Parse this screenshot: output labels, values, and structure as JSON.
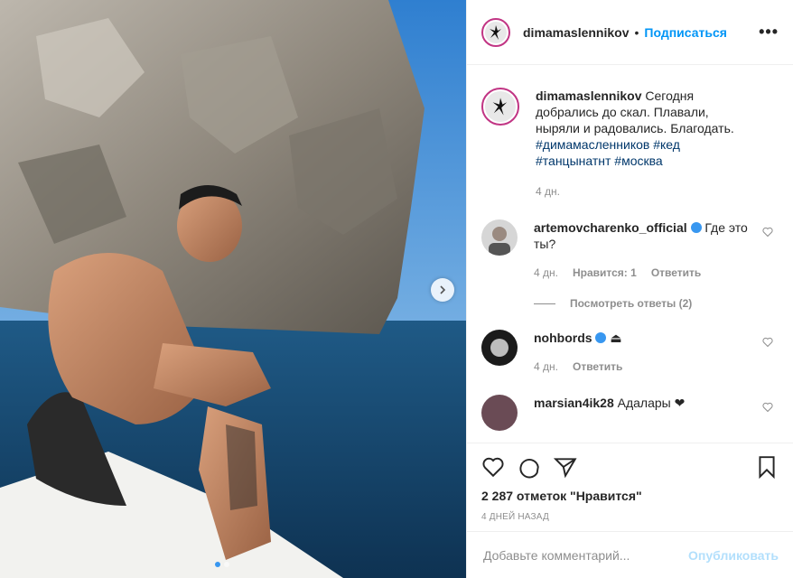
{
  "post": {
    "author": "dimamaslennikov",
    "separator": "•",
    "follow_label": "Подписаться",
    "more_label": "•••"
  },
  "caption": {
    "username": "dimamaslennikov",
    "text": "Сегодня добрались до скал. Плавали, ныряли и радовались. Благодать.",
    "hashtags": "#димамасленников #кед #танцынатнт #москва",
    "time": "4 дн."
  },
  "comments": [
    {
      "username": "artemovcharenko_official",
      "text": "Где это ты?",
      "time": "4 дн.",
      "likes": "Нравится: 1",
      "reply": "Ответить",
      "view_replies": "Посмотреть ответы (2)"
    },
    {
      "username": "nohbords",
      "text": "⏏",
      "time": "4 дн.",
      "reply": "Ответить"
    },
    {
      "username": "marsian4ik28",
      "text": "Адалары ❤"
    }
  ],
  "likes_text": "2 287 отметок \"Нравится\"",
  "timestamp": "4 дней назад",
  "add_comment": {
    "placeholder": "Добавьте комментарий...",
    "publish_label": "Опубликовать"
  },
  "colors": {
    "link": "#0095f6",
    "hashtag": "#00376b",
    "muted": "#8e8e8e",
    "verified": "#3897f0"
  }
}
